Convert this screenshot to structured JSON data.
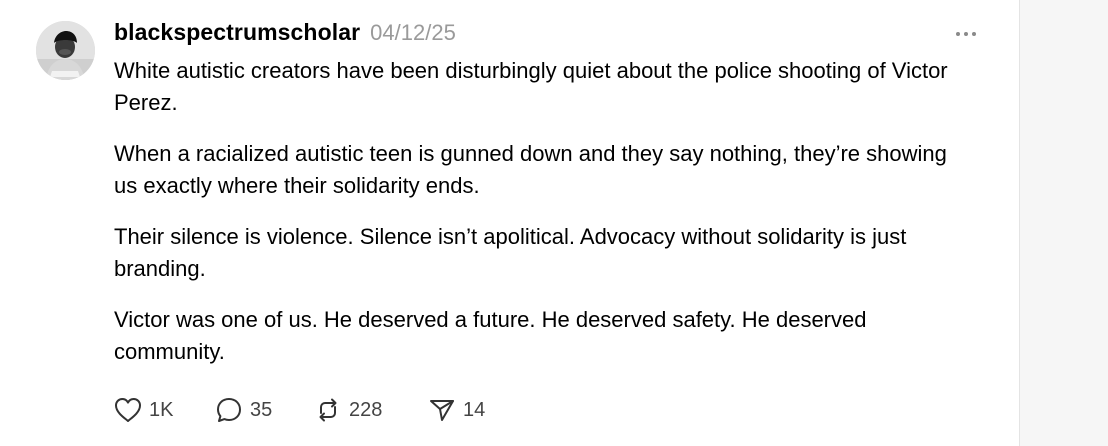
{
  "post": {
    "author": {
      "username": "blackspectrumscholar",
      "avatar_icon": "profile-photo"
    },
    "timestamp": "04/12/25",
    "more_icon": "ellipsis-icon",
    "paragraphs": [
      "White autistic creators have been disturbingly quiet about the police shooting of Victor Perez.",
      "When a racialized autistic teen is gunned down and they say nothing, they’re showing us exactly where their solidarity ends.",
      "Their silence is violence. Silence isn’t apolitical. Advocacy without solidarity is just branding.",
      "Victor was one of us. He deserved a future. He deserved safety. He deserved community."
    ],
    "actions": {
      "likes": "1K",
      "replies": "35",
      "reposts": "228",
      "shares": "14"
    }
  }
}
